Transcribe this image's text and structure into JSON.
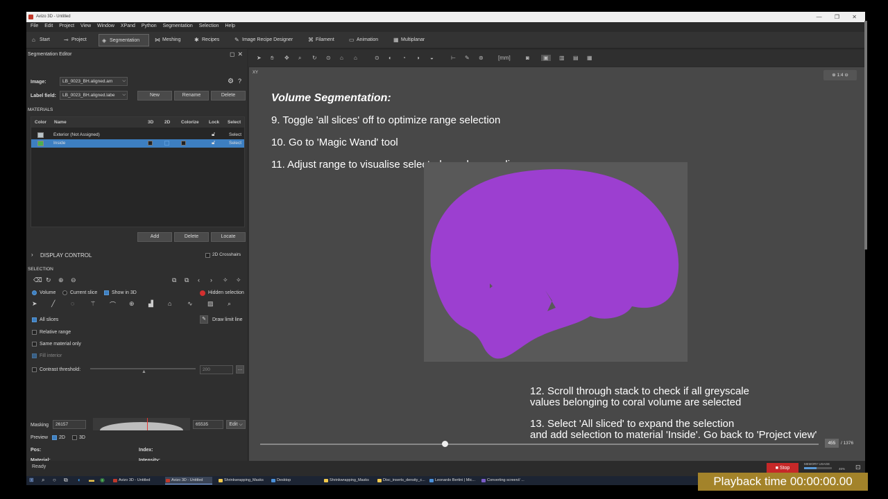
{
  "window": {
    "title": "Avizo 3D - Untitled",
    "controls": "— ❐ ✕"
  },
  "menu": [
    "File",
    "Edit",
    "Project",
    "View",
    "Window",
    "XPand",
    "Python",
    "Segmentation",
    "Selection",
    "Help"
  ],
  "toolbar": {
    "start": "Start",
    "project": "Project",
    "segmentation": "Segmentation",
    "meshing": "Meshing",
    "recipes": "Recipes",
    "image_recipe_designer": "Image Recipe Designer",
    "filament": "Filament",
    "animation": "Animation",
    "multiplanar": "Multiplanar"
  },
  "seg_editor": {
    "title": "Segmentation Editor",
    "image_label": "Image:",
    "image_value": "LB_0023_BH.aligned.am",
    "labelfield_label": "Label field:",
    "labelfield_value": "LB_0023_BH.aligned.labe",
    "new": "New",
    "rename": "Rename",
    "delete": "Delete",
    "materials_header": "MATERIALS",
    "columns": [
      "Color",
      "Name",
      "3D",
      "2D",
      "Colorize",
      "Lock",
      "Select"
    ],
    "materials": [
      {
        "name": "Exterior (Not Assigned)",
        "select": "Select",
        "color": "#b9c3c7"
      },
      {
        "name": "Inside",
        "select": "Select",
        "color": "#4caf50"
      }
    ],
    "add": "Add",
    "delete2": "Delete",
    "locate": "Locate",
    "display_control": "DISPLAY CONTROL",
    "crosshairs": "2D Crosshairs",
    "selection_header": "SELECTION",
    "volume": "Volume",
    "current_slice": "Current slice",
    "show_in_3d": "Show in 3D",
    "hidden_selection": "Hidden selection",
    "all_slices": "All slices",
    "draw_limit_line": "Draw limit line",
    "relative_range": "Relative range",
    "same_material_only": "Same material only",
    "fill_interior": "Fill interior",
    "contrast_threshold": "Contrast threshold:",
    "contrast_value": "200",
    "masking_label": "Masking",
    "masking_min": "26157",
    "masking_max": "65535",
    "edit": "Edit",
    "preview": "Preview",
    "p2d": "2D",
    "p3d": "3D",
    "pos": "Pos:",
    "index": "Index:",
    "material": "Material:",
    "intensity": "Intensity:"
  },
  "viewer": {
    "xy": "XY",
    "zoom": "1:4",
    "units": "[mm]",
    "title": "Volume Segmentation:",
    "step9": "9. Toggle 'all slices' off to optimize range selection",
    "step10": "10. Go to 'Magic Wand' tool",
    "step11": "11. Adjust range to visualise selected voxels on a slice",
    "step12a": "12. Scroll through stack to check if all greyscale",
    "step12b": "values belonging to coral volume are selected",
    "step13a": "13. Select 'All sliced' to expand the selection",
    "step13b": "and add selection to material 'Inside'. Go back to 'Project view'",
    "slice_current": "455",
    "slice_total": "/ 1376",
    "slice_fraction": 0.33,
    "overlay_color": "#9c3fd0"
  },
  "status": {
    "text": "Ready",
    "stop": "Stop",
    "memory": "MEMORY USAGE",
    "memory_pct": "46%"
  },
  "taskbar": [
    {
      "label": "Avizo 3D - Untitled",
      "color": "#c0392b"
    },
    {
      "label": "Avizo 3D - Untitled",
      "color": "#c0392b"
    },
    {
      "label": "Shrinkwrapping_Masks",
      "color": "#f2c94c"
    },
    {
      "label": "Desktop",
      "color": "#4a90d9"
    },
    {
      "label": "Shrinkwrapping_Masks",
      "color": "#f2c94c"
    },
    {
      "label": "Disc_inserts_density_c...",
      "color": "#f2c94c"
    },
    {
      "label": "Leonardo Bertini | Mic...",
      "color": "#4a90d9"
    },
    {
      "label": "Converting screen// ...",
      "color": "#7a5cc7"
    }
  ],
  "playback": "Playback time 00:00:00.00"
}
